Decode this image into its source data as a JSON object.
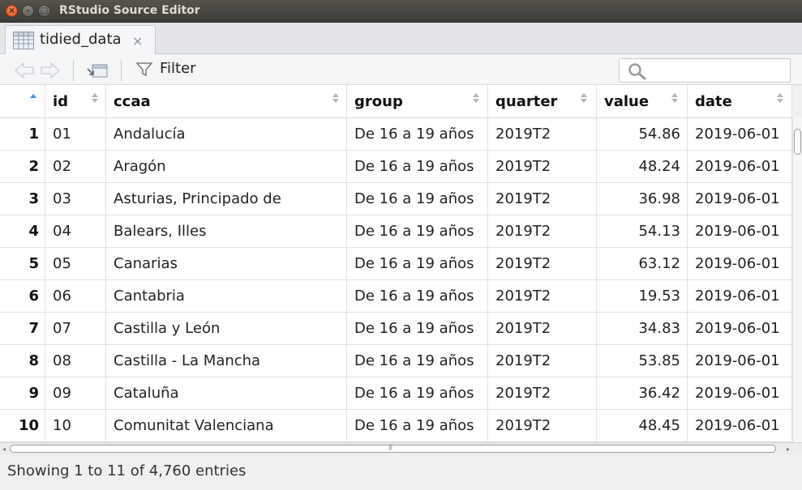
{
  "window": {
    "title": "RStudio Source Editor",
    "close_glyph": "×",
    "min_glyph": "–",
    "max_glyph": "□"
  },
  "tab": {
    "label": "tidied_data",
    "close_glyph": "×",
    "icon": "table-icon"
  },
  "toolbar": {
    "filter_label": "Filter",
    "search_value": "",
    "search_placeholder": ""
  },
  "table": {
    "columns": [
      "",
      "id",
      "ccaa",
      "group",
      "quarter",
      "value",
      "date"
    ],
    "rows": [
      {
        "n": "1",
        "id": "01",
        "ccaa": "Andalucía",
        "group": "De 16 a 19 años",
        "quarter": "2019T2",
        "value": "54.86",
        "date": "2019-06-01"
      },
      {
        "n": "2",
        "id": "02",
        "ccaa": "Aragón",
        "group": "De 16 a 19 años",
        "quarter": "2019T2",
        "value": "48.24",
        "date": "2019-06-01"
      },
      {
        "n": "3",
        "id": "03",
        "ccaa": "Asturias, Principado de",
        "group": "De 16 a 19 años",
        "quarter": "2019T2",
        "value": "36.98",
        "date": "2019-06-01"
      },
      {
        "n": "4",
        "id": "04",
        "ccaa": "Balears, Illes",
        "group": "De 16 a 19 años",
        "quarter": "2019T2",
        "value": "54.13",
        "date": "2019-06-01"
      },
      {
        "n": "5",
        "id": "05",
        "ccaa": "Canarias",
        "group": "De 16 a 19 años",
        "quarter": "2019T2",
        "value": "63.12",
        "date": "2019-06-01"
      },
      {
        "n": "6",
        "id": "06",
        "ccaa": "Cantabria",
        "group": "De 16 a 19 años",
        "quarter": "2019T2",
        "value": "19.53",
        "date": "2019-06-01"
      },
      {
        "n": "7",
        "id": "07",
        "ccaa": "Castilla y León",
        "group": "De 16 a 19 años",
        "quarter": "2019T2",
        "value": "34.83",
        "date": "2019-06-01"
      },
      {
        "n": "8",
        "id": "08",
        "ccaa": "Castilla - La Mancha",
        "group": "De 16 a 19 años",
        "quarter": "2019T2",
        "value": "53.85",
        "date": "2019-06-01"
      },
      {
        "n": "9",
        "id": "09",
        "ccaa": "Cataluña",
        "group": "De 16 a 19 años",
        "quarter": "2019T2",
        "value": "36.42",
        "date": "2019-06-01"
      },
      {
        "n": "10",
        "id": "10",
        "ccaa": "Comunitat Valenciana",
        "group": "De 16 a 19 años",
        "quarter": "2019T2",
        "value": "48.45",
        "date": "2019-06-01"
      }
    ]
  },
  "status": {
    "text": "Showing 1 to 11 of 4,760 entries"
  },
  "colors": {
    "sort_active": "#3a8ee6",
    "sort_inactive": "#b5b5b5"
  }
}
